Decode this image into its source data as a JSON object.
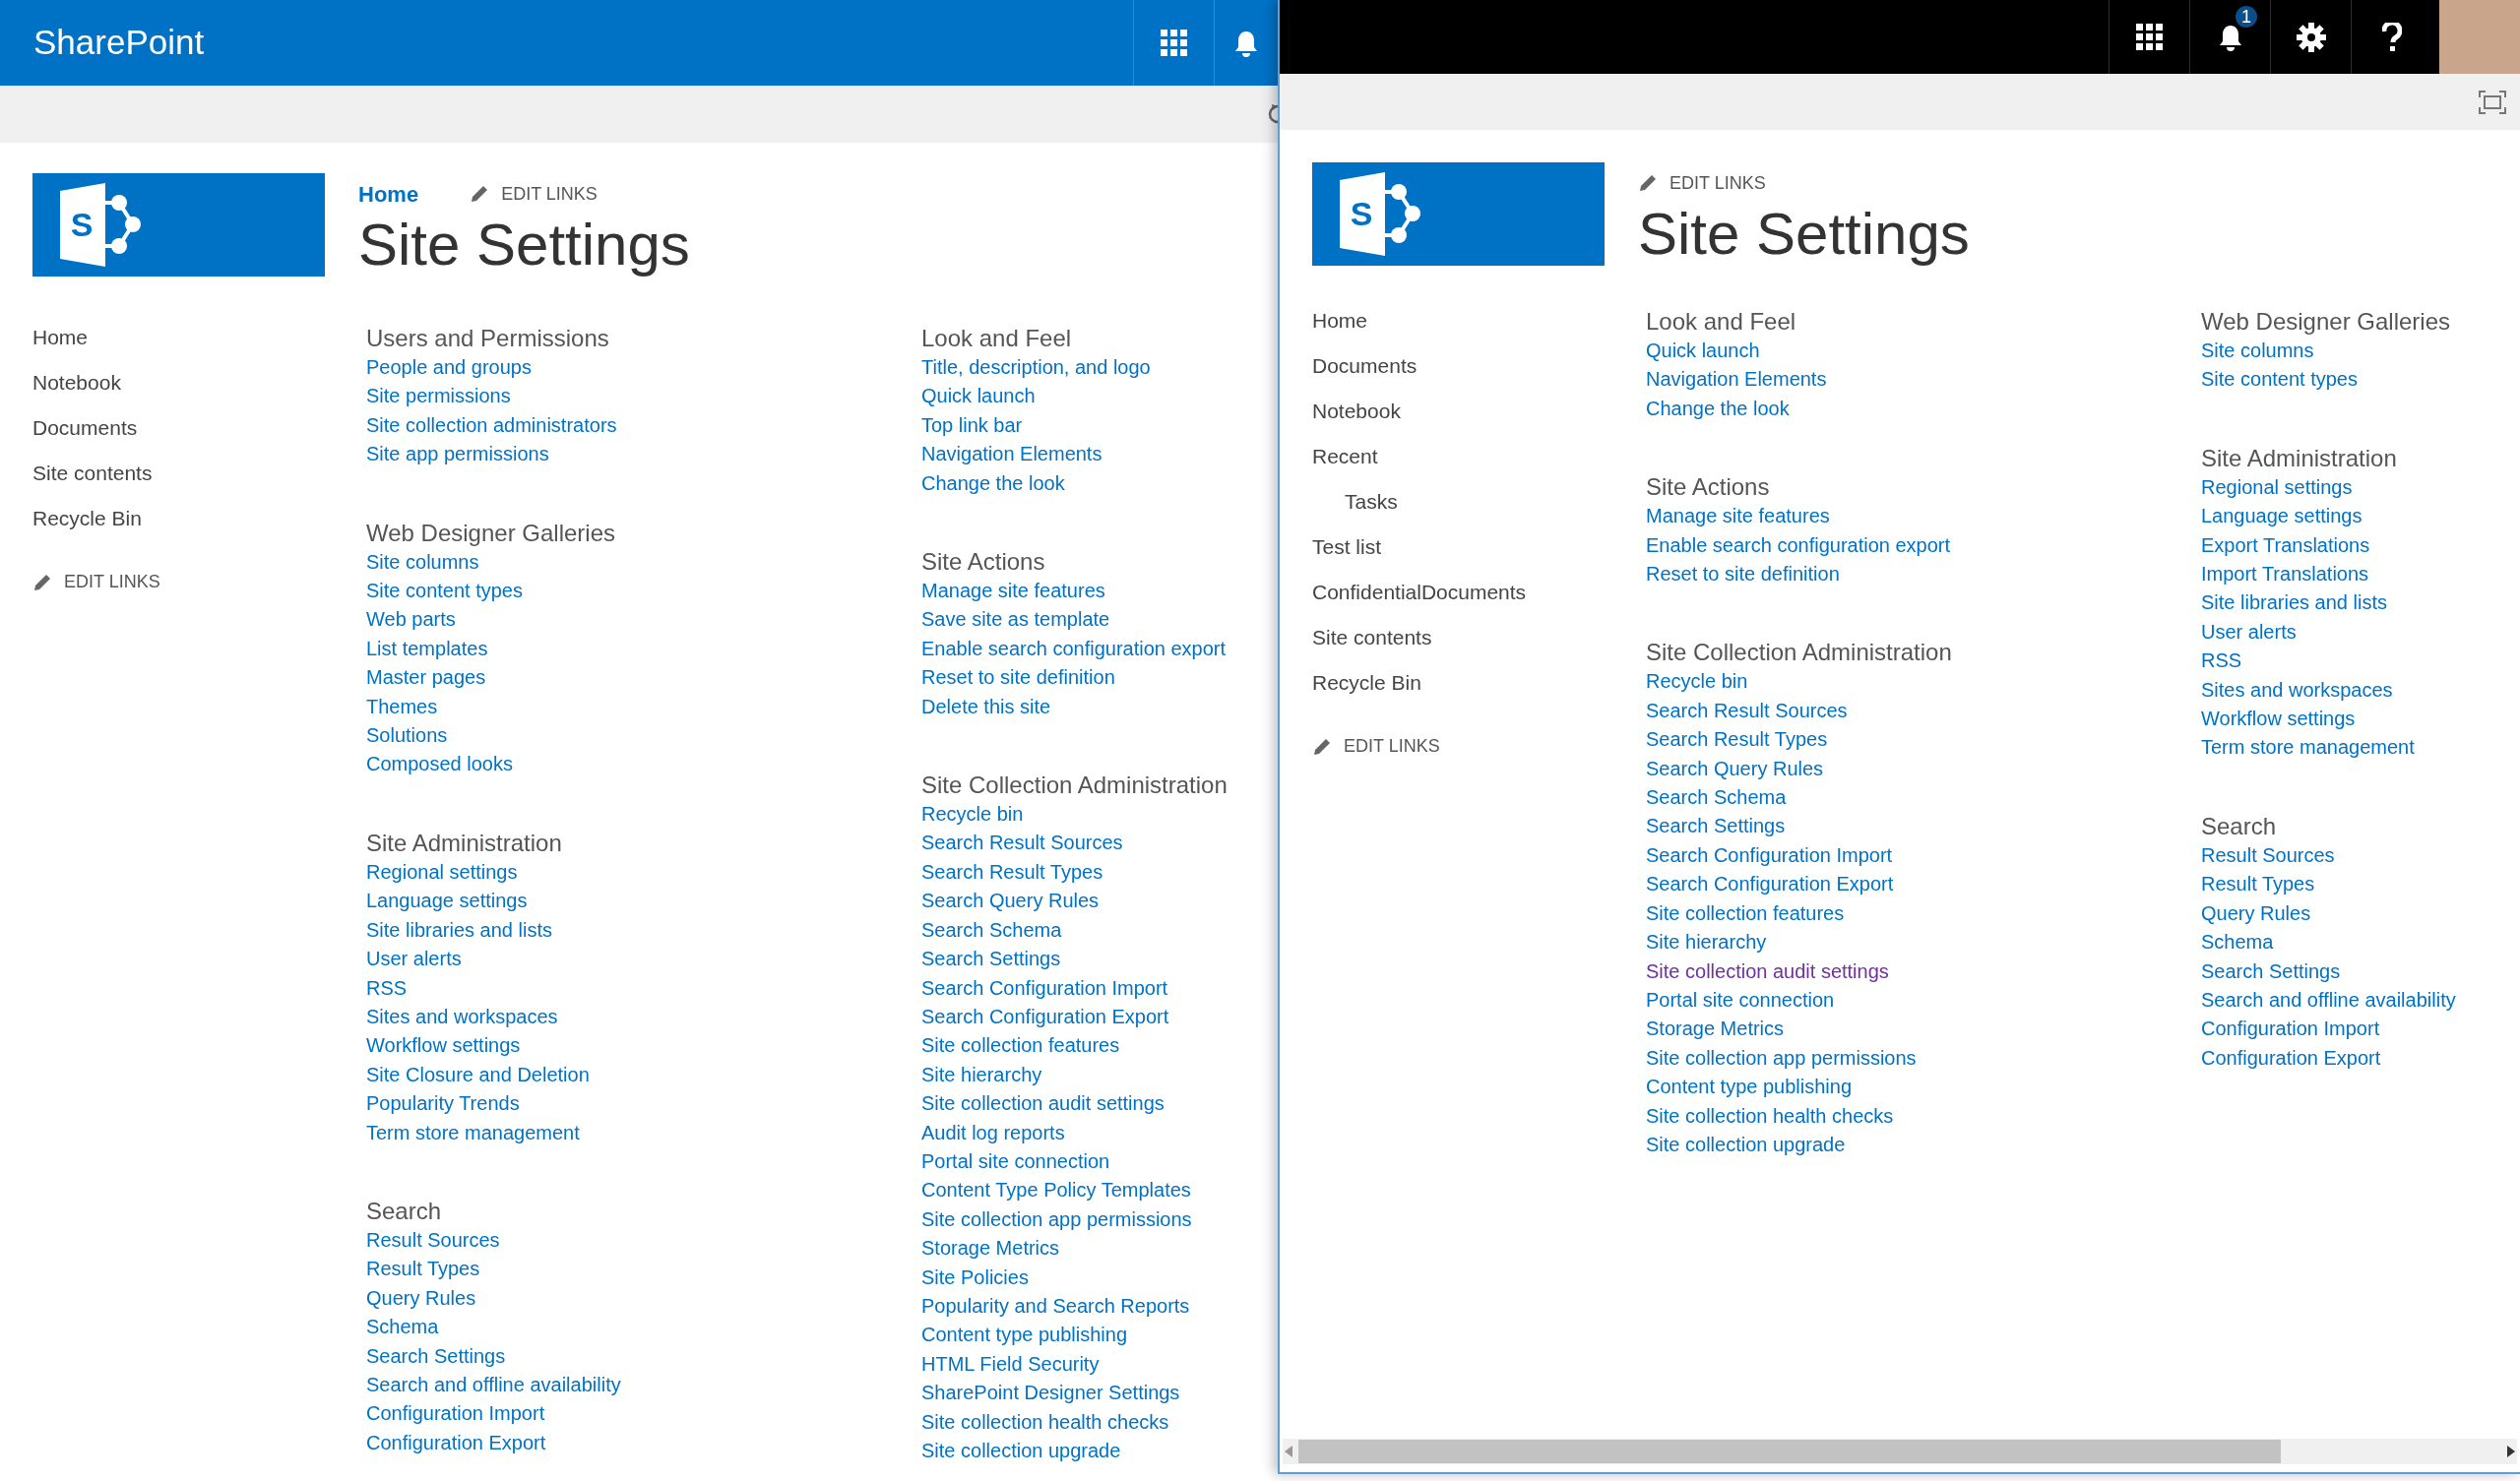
{
  "windows": [
    {
      "kind": "back",
      "brand": "SharePoint",
      "logo_letter": "S",
      "breadcrumb": "Home",
      "edit_links": "EDIT LINKS",
      "title": "Site Settings",
      "nav": [
        {
          "label": "Home"
        },
        {
          "label": "Notebook"
        },
        {
          "label": "Documents"
        },
        {
          "label": "Site contents"
        },
        {
          "label": "Recycle Bin"
        }
      ],
      "nav_edit_links": "EDIT LINKS",
      "columns": [
        [
          {
            "heading": "Users and Permissions",
            "links": [
              {
                "label": "People and groups",
                "visited": false
              },
              {
                "label": "Site permissions",
                "visited": false
              },
              {
                "label": "Site collection administrators",
                "visited": false
              },
              {
                "label": "Site app permissions",
                "visited": false
              }
            ]
          },
          {
            "heading": "Web Designer Galleries",
            "links": [
              {
                "label": "Site columns",
                "visited": false
              },
              {
                "label": "Site content types",
                "visited": false
              },
              {
                "label": "Web parts",
                "visited": false
              },
              {
                "label": "List templates",
                "visited": false
              },
              {
                "label": "Master pages",
                "visited": false
              },
              {
                "label": "Themes",
                "visited": false
              },
              {
                "label": "Solutions",
                "visited": false
              },
              {
                "label": "Composed looks",
                "visited": false
              }
            ]
          },
          {
            "heading": "Site Administration",
            "links": [
              {
                "label": "Regional settings",
                "visited": false
              },
              {
                "label": "Language settings",
                "visited": false
              },
              {
                "label": "Site libraries and lists",
                "visited": false
              },
              {
                "label": "User alerts",
                "visited": false
              },
              {
                "label": "RSS",
                "visited": false
              },
              {
                "label": "Sites and workspaces",
                "visited": false
              },
              {
                "label": "Workflow settings",
                "visited": false
              },
              {
                "label": "Site Closure and Deletion",
                "visited": false
              },
              {
                "label": "Popularity Trends",
                "visited": false
              },
              {
                "label": "Term store management",
                "visited": false
              }
            ]
          },
          {
            "heading": "Search",
            "links": [
              {
                "label": "Result Sources",
                "visited": false
              },
              {
                "label": "Result Types",
                "visited": false
              },
              {
                "label": "Query Rules",
                "visited": false
              },
              {
                "label": "Schema",
                "visited": false
              },
              {
                "label": "Search Settings",
                "visited": false
              },
              {
                "label": "Search and offline availability",
                "visited": false
              },
              {
                "label": "Configuration Import",
                "visited": false
              },
              {
                "label": "Configuration Export",
                "visited": false
              }
            ]
          }
        ],
        [
          {
            "heading": "Look and Feel",
            "links": [
              {
                "label": "Title, description, and logo",
                "visited": false
              },
              {
                "label": "Quick launch",
                "visited": false
              },
              {
                "label": "Top link bar",
                "visited": false
              },
              {
                "label": "Navigation Elements",
                "visited": false
              },
              {
                "label": "Change the look",
                "visited": false
              }
            ]
          },
          {
            "heading": "Site Actions",
            "links": [
              {
                "label": "Manage site features",
                "visited": false
              },
              {
                "label": "Save site as template",
                "visited": false
              },
              {
                "label": "Enable search configuration export",
                "visited": false
              },
              {
                "label": "Reset to site definition",
                "visited": false
              },
              {
                "label": "Delete this site",
                "visited": false
              }
            ]
          },
          {
            "heading": "Site Collection Administration",
            "links": [
              {
                "label": "Recycle bin",
                "visited": false
              },
              {
                "label": "Search Result Sources",
                "visited": false
              },
              {
                "label": "Search Result Types",
                "visited": false
              },
              {
                "label": "Search Query Rules",
                "visited": false
              },
              {
                "label": "Search Schema",
                "visited": false
              },
              {
                "label": "Search Settings",
                "visited": false
              },
              {
                "label": "Search Configuration Import",
                "visited": false
              },
              {
                "label": "Search Configuration Export",
                "visited": false
              },
              {
                "label": "Site collection features",
                "visited": false
              },
              {
                "label": "Site hierarchy",
                "visited": false
              },
              {
                "label": "Site collection audit settings",
                "visited": false
              },
              {
                "label": "Audit log reports",
                "visited": false
              },
              {
                "label": "Portal site connection",
                "visited": false
              },
              {
                "label": "Content Type Policy Templates",
                "visited": false
              },
              {
                "label": "Site collection app permissions",
                "visited": false
              },
              {
                "label": "Storage Metrics",
                "visited": false
              },
              {
                "label": "Site Policies",
                "visited": false
              },
              {
                "label": "Popularity and Search Reports",
                "visited": false
              },
              {
                "label": "Content type publishing",
                "visited": false
              },
              {
                "label": "HTML Field Security",
                "visited": false
              },
              {
                "label": "SharePoint Designer Settings",
                "visited": false
              },
              {
                "label": "Site collection health checks",
                "visited": false
              },
              {
                "label": "Site collection upgrade",
                "visited": false
              }
            ]
          }
        ]
      ]
    },
    {
      "kind": "front",
      "notification_count": "1",
      "logo_letter": "S",
      "edit_links": "EDIT LINKS",
      "title": "Site Settings",
      "nav": [
        {
          "label": "Home"
        },
        {
          "label": "Documents"
        },
        {
          "label": "Notebook"
        },
        {
          "label": "Recent",
          "children": [
            {
              "label": "Tasks"
            }
          ]
        },
        {
          "label": "Test list"
        },
        {
          "label": "ConfidentialDocuments"
        },
        {
          "label": "Site contents"
        },
        {
          "label": "Recycle Bin"
        }
      ],
      "nav_edit_links": "EDIT LINKS",
      "columns": [
        [
          {
            "heading": "Look and Feel",
            "links": [
              {
                "label": "Quick launch",
                "visited": false
              },
              {
                "label": "Navigation Elements",
                "visited": false
              },
              {
                "label": "Change the look",
                "visited": false
              }
            ]
          },
          {
            "heading": "Site Actions",
            "links": [
              {
                "label": "Manage site features",
                "visited": false
              },
              {
                "label": "Enable search configuration export",
                "visited": false
              },
              {
                "label": "Reset to site definition",
                "visited": false
              }
            ]
          },
          {
            "heading": "Site Collection Administration",
            "links": [
              {
                "label": "Recycle bin",
                "visited": false
              },
              {
                "label": "Search Result Sources",
                "visited": false
              },
              {
                "label": "Search Result Types",
                "visited": false
              },
              {
                "label": "Search Query Rules",
                "visited": false
              },
              {
                "label": "Search Schema",
                "visited": false
              },
              {
                "label": "Search Settings",
                "visited": false
              },
              {
                "label": "Search Configuration Import",
                "visited": false
              },
              {
                "label": "Search Configuration Export",
                "visited": false
              },
              {
                "label": "Site collection features",
                "visited": false
              },
              {
                "label": "Site hierarchy",
                "visited": false
              },
              {
                "label": "Site collection audit settings",
                "visited": true
              },
              {
                "label": "Portal site connection",
                "visited": false
              },
              {
                "label": "Storage Metrics",
                "visited": false
              },
              {
                "label": "Site collection app permissions",
                "visited": false
              },
              {
                "label": "Content type publishing",
                "visited": false
              },
              {
                "label": "Site collection health checks",
                "visited": false
              },
              {
                "label": "Site collection upgrade",
                "visited": false
              }
            ]
          }
        ],
        [
          {
            "heading": "Web Designer Galleries",
            "links": [
              {
                "label": "Site columns",
                "visited": false
              },
              {
                "label": "Site content types",
                "visited": false
              }
            ]
          },
          {
            "heading": "Site Administration",
            "links": [
              {
                "label": "Regional settings",
                "visited": false
              },
              {
                "label": "Language settings",
                "visited": false
              },
              {
                "label": "Export Translations",
                "visited": false
              },
              {
                "label": "Import Translations",
                "visited": false
              },
              {
                "label": "Site libraries and lists",
                "visited": false
              },
              {
                "label": "User alerts",
                "visited": false
              },
              {
                "label": "RSS",
                "visited": false
              },
              {
                "label": "Sites and workspaces",
                "visited": false
              },
              {
                "label": "Workflow settings",
                "visited": false
              },
              {
                "label": "Term store management",
                "visited": false
              }
            ]
          },
          {
            "heading": "Search",
            "links": [
              {
                "label": "Result Sources",
                "visited": false
              },
              {
                "label": "Result Types",
                "visited": false
              },
              {
                "label": "Query Rules",
                "visited": false
              },
              {
                "label": "Schema",
                "visited": false
              },
              {
                "label": "Search Settings",
                "visited": false
              },
              {
                "label": "Search and offline availability",
                "visited": false
              },
              {
                "label": "Configuration Import",
                "visited": false
              },
              {
                "label": "Configuration Export",
                "visited": false
              }
            ]
          }
        ]
      ]
    }
  ]
}
